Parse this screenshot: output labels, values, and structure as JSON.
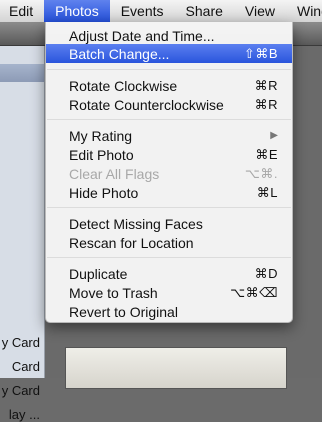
{
  "menubar": {
    "items": [
      "Edit",
      "Photos",
      "Events",
      "Share",
      "View",
      "Wind"
    ],
    "active_index": 1
  },
  "sidebar": {
    "items": [
      "y Card",
      "Card",
      "y Card",
      "lay ..."
    ]
  },
  "menu": {
    "items": [
      {
        "label": "Adjust Date and Time...",
        "shortcut": ""
      },
      {
        "label": "Batch Change...",
        "shortcut": "⇧⌘B"
      },
      {
        "label": "Rotate Clockwise",
        "shortcut": "⌘R"
      },
      {
        "label": "Rotate Counterclockwise",
        "shortcut": "⌘R"
      },
      {
        "label": "My Rating",
        "shortcut": "▶"
      },
      {
        "label": "Edit Photo",
        "shortcut": "⌘E"
      },
      {
        "label": "Clear All Flags",
        "shortcut": "⌥⌘."
      },
      {
        "label": "Hide Photo",
        "shortcut": "⌘L"
      },
      {
        "label": "Detect Missing Faces",
        "shortcut": ""
      },
      {
        "label": "Rescan for Location",
        "shortcut": ""
      },
      {
        "label": "Duplicate",
        "shortcut": "⌘D"
      },
      {
        "label": "Move to Trash",
        "shortcut": "⌥⌘⌫"
      },
      {
        "label": "Revert to Original",
        "shortcut": ""
      }
    ],
    "highlighted_index": 1,
    "disabled_indices": [
      6
    ]
  },
  "colors": {
    "highlight": "#2a55dc",
    "disabled_text": "#a8a8a8"
  }
}
